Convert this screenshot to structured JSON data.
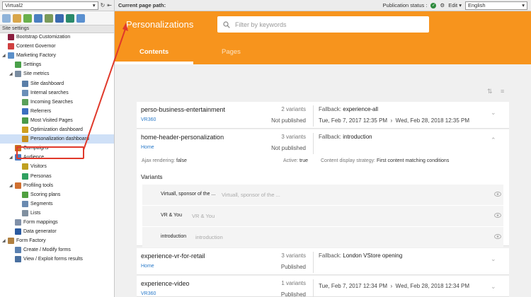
{
  "site": {
    "name": "Virtual2",
    "settings_label": "Site settings"
  },
  "tree": [
    {
      "label": "Bootstrap Customization",
      "indent": 0,
      "color": "#8b1e3f"
    },
    {
      "label": "Content Governor",
      "indent": 0,
      "color": "#d04040"
    },
    {
      "label": "Marketing Factory",
      "indent": 0,
      "color": "#5b8fc9",
      "expanded": true
    },
    {
      "label": "Settings",
      "indent": 1,
      "color": "#4aa04a"
    },
    {
      "label": "Site metrics",
      "indent": 1,
      "color": "#7a8ca0",
      "expanded": true
    },
    {
      "label": "Site dashboard",
      "indent": 2,
      "color": "#5a7fa8"
    },
    {
      "label": "Internal searches",
      "indent": 2,
      "color": "#6a8fb8"
    },
    {
      "label": "Incoming Searches",
      "indent": 2,
      "color": "#5aa05a"
    },
    {
      "label": "Referrers",
      "indent": 2,
      "color": "#3c6fc0"
    },
    {
      "label": "Most Visited Pages",
      "indent": 2,
      "color": "#4a9a4a"
    },
    {
      "label": "Optimization dashboard",
      "indent": 2,
      "color": "#d0a020"
    },
    {
      "label": "Personalization dashboard",
      "indent": 2,
      "color": "#c89020",
      "selected": true
    },
    {
      "label": "Campaigns",
      "indent": 1,
      "color": "#c87020"
    },
    {
      "label": "Audience",
      "indent": 1,
      "color": "#4a7ac0",
      "expanded": true
    },
    {
      "label": "Visitors",
      "indent": 2,
      "color": "#c0a020"
    },
    {
      "label": "Personas",
      "indent": 2,
      "color": "#30a060"
    },
    {
      "label": "Profiling tools",
      "indent": 1,
      "color": "#d07030",
      "expanded": true
    },
    {
      "label": "Scoring plans",
      "indent": 2,
      "color": "#50a040"
    },
    {
      "label": "Segments",
      "indent": 2,
      "color": "#6a8ab0"
    },
    {
      "label": "Lists",
      "indent": 2,
      "color": "#8090a0"
    },
    {
      "label": "Form mappings",
      "indent": 1,
      "color": "#8090a8"
    },
    {
      "label": "Data generator",
      "indent": 1,
      "color": "#2a5aa0"
    },
    {
      "label": "Form Factory",
      "indent": 0,
      "color": "#b08040",
      "expanded": true
    },
    {
      "label": "Create / Modify forms",
      "indent": 1,
      "color": "#5a80b0"
    },
    {
      "label": "View / Exploit forms results",
      "indent": 1,
      "color": "#4a70a0"
    }
  ],
  "topbar": {
    "path_label": "Current page path:",
    "publication_status": "Publication status :",
    "edit_label": "Edit",
    "language": "English"
  },
  "header": {
    "title": "Personalizations",
    "search_placeholder": "Filter by keywords",
    "tabs": [
      "Contents",
      "Pages"
    ]
  },
  "cards": [
    {
      "name": "perso-business-entertainment",
      "tag": "VR360",
      "variants": "2 variants",
      "status": "Not published",
      "fallback_label": "Fallback:",
      "fallback": "experience-all",
      "start": "Tue, Feb 7, 2017 12:35 PM",
      "end": "Wed, Feb 28, 2018 12:35 PM"
    },
    {
      "name": "home-header-personalization",
      "tag": "Home",
      "variants": "3 variants",
      "status": "Not published",
      "fallback_label": "Fallback:",
      "fallback": "introduction",
      "ajax_label": "Ajax rendering:",
      "ajax": "false",
      "active_label": "Active:",
      "active": "true",
      "strategy_label": "Content display strategy:",
      "strategy": "First content matching conditions",
      "variants_heading": "Variants",
      "variant_rows": [
        {
          "name": "Virtuall, sponsor of the ...",
          "ghost": "Virtuall, sponsor of the ..."
        },
        {
          "name": "VR & You",
          "ghost": "VR & You"
        },
        {
          "name": "introduction",
          "ghost": "introduction"
        }
      ]
    },
    {
      "name": "experience-vr-for-retail",
      "tag": "Home",
      "variants": "3 variants",
      "status": "Published",
      "fallback_label": "Fallback:",
      "fallback": "London VStore opening"
    },
    {
      "name": "experience-video",
      "tag": "VR360",
      "variants": "1 variants",
      "status": "Published",
      "start": "Tue, Feb 7, 2017 12:34 PM",
      "end": "Wed, Feb 28, 2018 12:34 PM"
    }
  ],
  "colors": {
    "accent": "#f7941d",
    "link": "#2a7ac9",
    "highlight": "#e0392b"
  }
}
